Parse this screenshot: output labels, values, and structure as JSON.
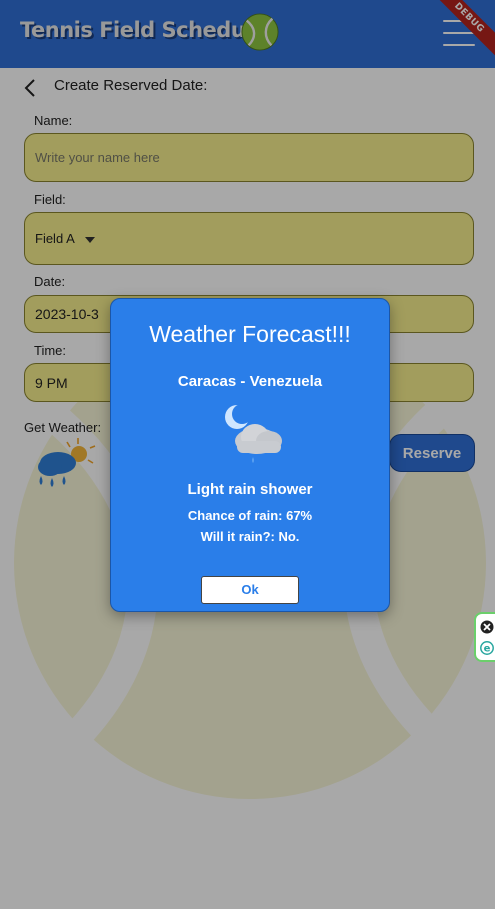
{
  "appbar": {
    "title": "Tennis Field Scheduler",
    "debug_banner": "DEBUG",
    "logo_icon": "tennis-ball-icon",
    "menu_icon": "hamburger-menu-icon",
    "color": "#2f6fd6"
  },
  "page": {
    "title": "Create Reserved Date:",
    "back_icon": "chevron-left-icon"
  },
  "form": {
    "name_label": "Name:",
    "name_placeholder": "Write your name here",
    "field_label": "Field:",
    "field_value": "Field A",
    "date_label": "Date:",
    "date_value": "2023-10-3",
    "time_label": "Time:",
    "time_value": "9 PM",
    "weather_label": "Get Weather:",
    "weather_icon": "rain-shower-icon",
    "reserve_label": "Reserve",
    "input_color": "#f6ee8e"
  },
  "dialog": {
    "title": "Weather Forecast!!!",
    "location": "Caracas - Venezuela",
    "icon": "night-cloud-icon",
    "condition": "Light rain shower",
    "chance": "Chance of rain: 67%",
    "will_rain": "Will it rain?: No.",
    "ok_label": "Ok",
    "color": "#2a7ee9"
  },
  "side_widget": {
    "close_icon": "close-icon",
    "extension_icon": "e-icon",
    "color": "#6bcf6b"
  }
}
